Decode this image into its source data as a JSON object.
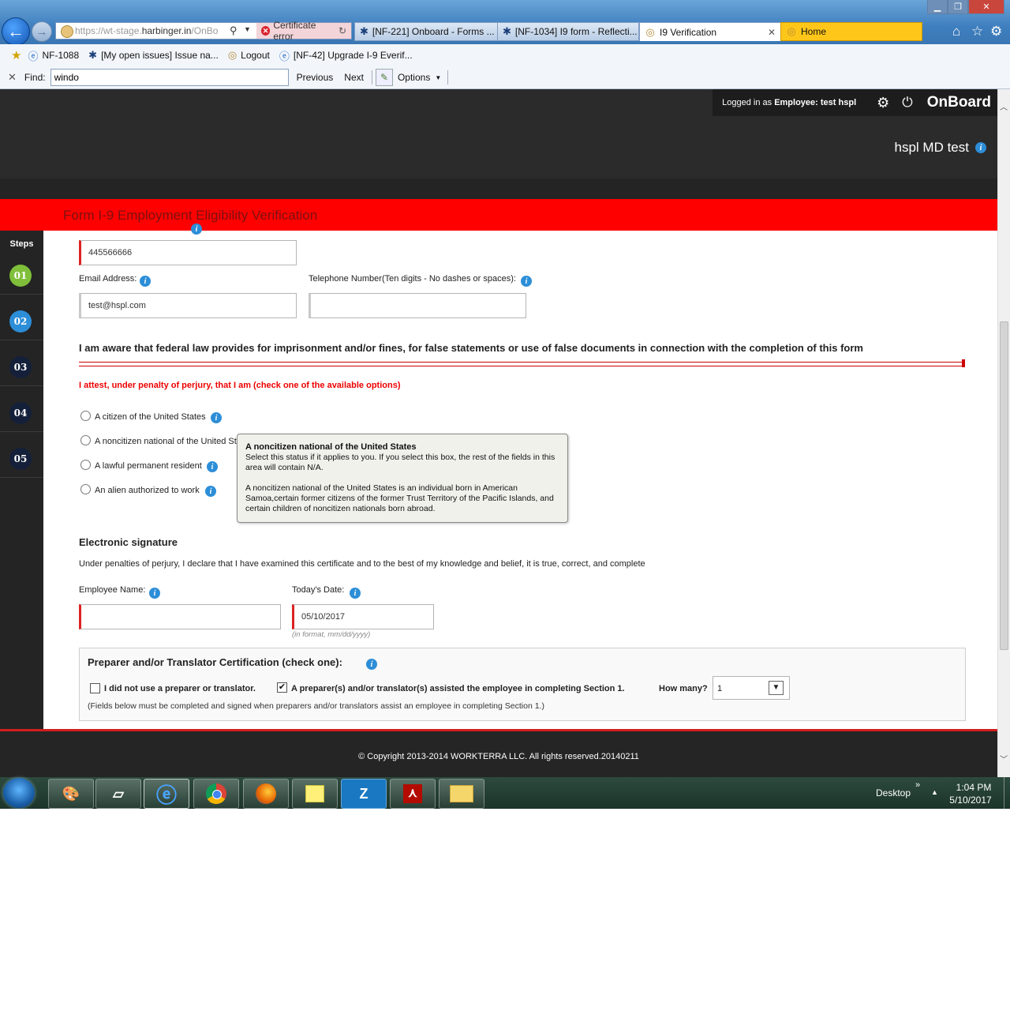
{
  "browser": {
    "address": {
      "url_prefix": "https://wt-stage.",
      "url_domain": "harbinger.in",
      "url_suffix": "/OnBo",
      "cert_error": "Certificate error"
    },
    "tabs": [
      {
        "label": "[NF-221] Onboard - Forms ..."
      },
      {
        "label": "[NF-1034] I9 form - Reflecti..."
      },
      {
        "label": "I9 Verification",
        "active": true
      },
      {
        "label": "Home"
      }
    ],
    "favorites": [
      {
        "label": "NF-1088"
      },
      {
        "label": "[My open issues] Issue na..."
      },
      {
        "label": "Logout"
      },
      {
        "label": "[NF-42] Upgrade I-9 Everif..."
      }
    ],
    "find_bar": {
      "label": "Find:",
      "value": "windo",
      "previous": "Previous",
      "next": "Next",
      "options": "Options"
    }
  },
  "header": {
    "logged_in_prefix": "Logged in as",
    "logged_in_role": "Employee:",
    "logged_in_user": "test hspl",
    "brand": "OnBoard",
    "user_title": "hspl MD test"
  },
  "form": {
    "title": "Form I-9 Employment Eligibility Verification",
    "steps_label": "Steps",
    "steps": [
      {
        "label": "01",
        "color": "#7fbf3a"
      },
      {
        "label": "02",
        "color": "#2d8ed8"
      },
      {
        "label": "03",
        "color": "#14203a"
      },
      {
        "label": "04",
        "color": "#14203a"
      },
      {
        "label": "05",
        "color": "#14203a"
      }
    ],
    "ssn_value": "445566666",
    "email_label": "Email Address:",
    "email_value": "test@hspl.com",
    "phone_label": "Telephone Number(Ten digits - No dashes or spaces):",
    "phone_value": "",
    "warning": "I am aware that federal law provides for imprisonment and/or fines, for false statements or use of false documents in connection with the completion of this form",
    "attest": "I attest, under penalty of perjury, that I am (check one of the available options)",
    "options": [
      "A citizen of the United States",
      "A noncitizen national of the United St",
      "A lawful permanent resident",
      "An alien authorized to work"
    ],
    "tooltip": {
      "title": "A noncitizen national of the United States",
      "line1": "Select this status if it applies to you. If you select this box, the rest of the fields in this area will contain N/A.",
      "line2": "A noncitizen national of the United States is an individual born in American Samoa,certain former citizens of the former Trust Territory of the Pacific Islands, and certain children of noncitizen nationals born abroad."
    },
    "signature_heading": "Electronic signature",
    "signature_text": "Under penalties of perjury, I declare that I have examined this certificate and to the best of my knowledge and belief, it is true, correct, and complete",
    "employee_name_label": "Employee Name:",
    "employee_name_value": "",
    "date_label": "Today's Date:",
    "date_value": "05/10/2017",
    "date_hint": "(in format, mm/dd/yyyy)",
    "preparer": {
      "heading": "Preparer and/or Translator Certification (check one):",
      "opt_none": "I did not use a preparer or translator.",
      "opt_assisted": "A preparer(s) and/or translator(s) assisted the employee in completing Section 1.",
      "how_many_label": "How many?",
      "how_many_value": "1",
      "note": "(Fields below must be completed and signed when preparers and/or translators assist an employee in completing Section 1.)"
    }
  },
  "footer": {
    "copyright": "© Copyright 2013-2014 WORKTERRA LLC. All rights reserved.20140211"
  },
  "taskbar": {
    "apps": [
      "paint",
      "notepad",
      "ie",
      "chrome",
      "firefox",
      "sticky-notes",
      "Z",
      "acrobat",
      "explorer"
    ],
    "desktop_label": "Desktop",
    "time": "1:04 PM",
    "date": "5/10/2017"
  }
}
